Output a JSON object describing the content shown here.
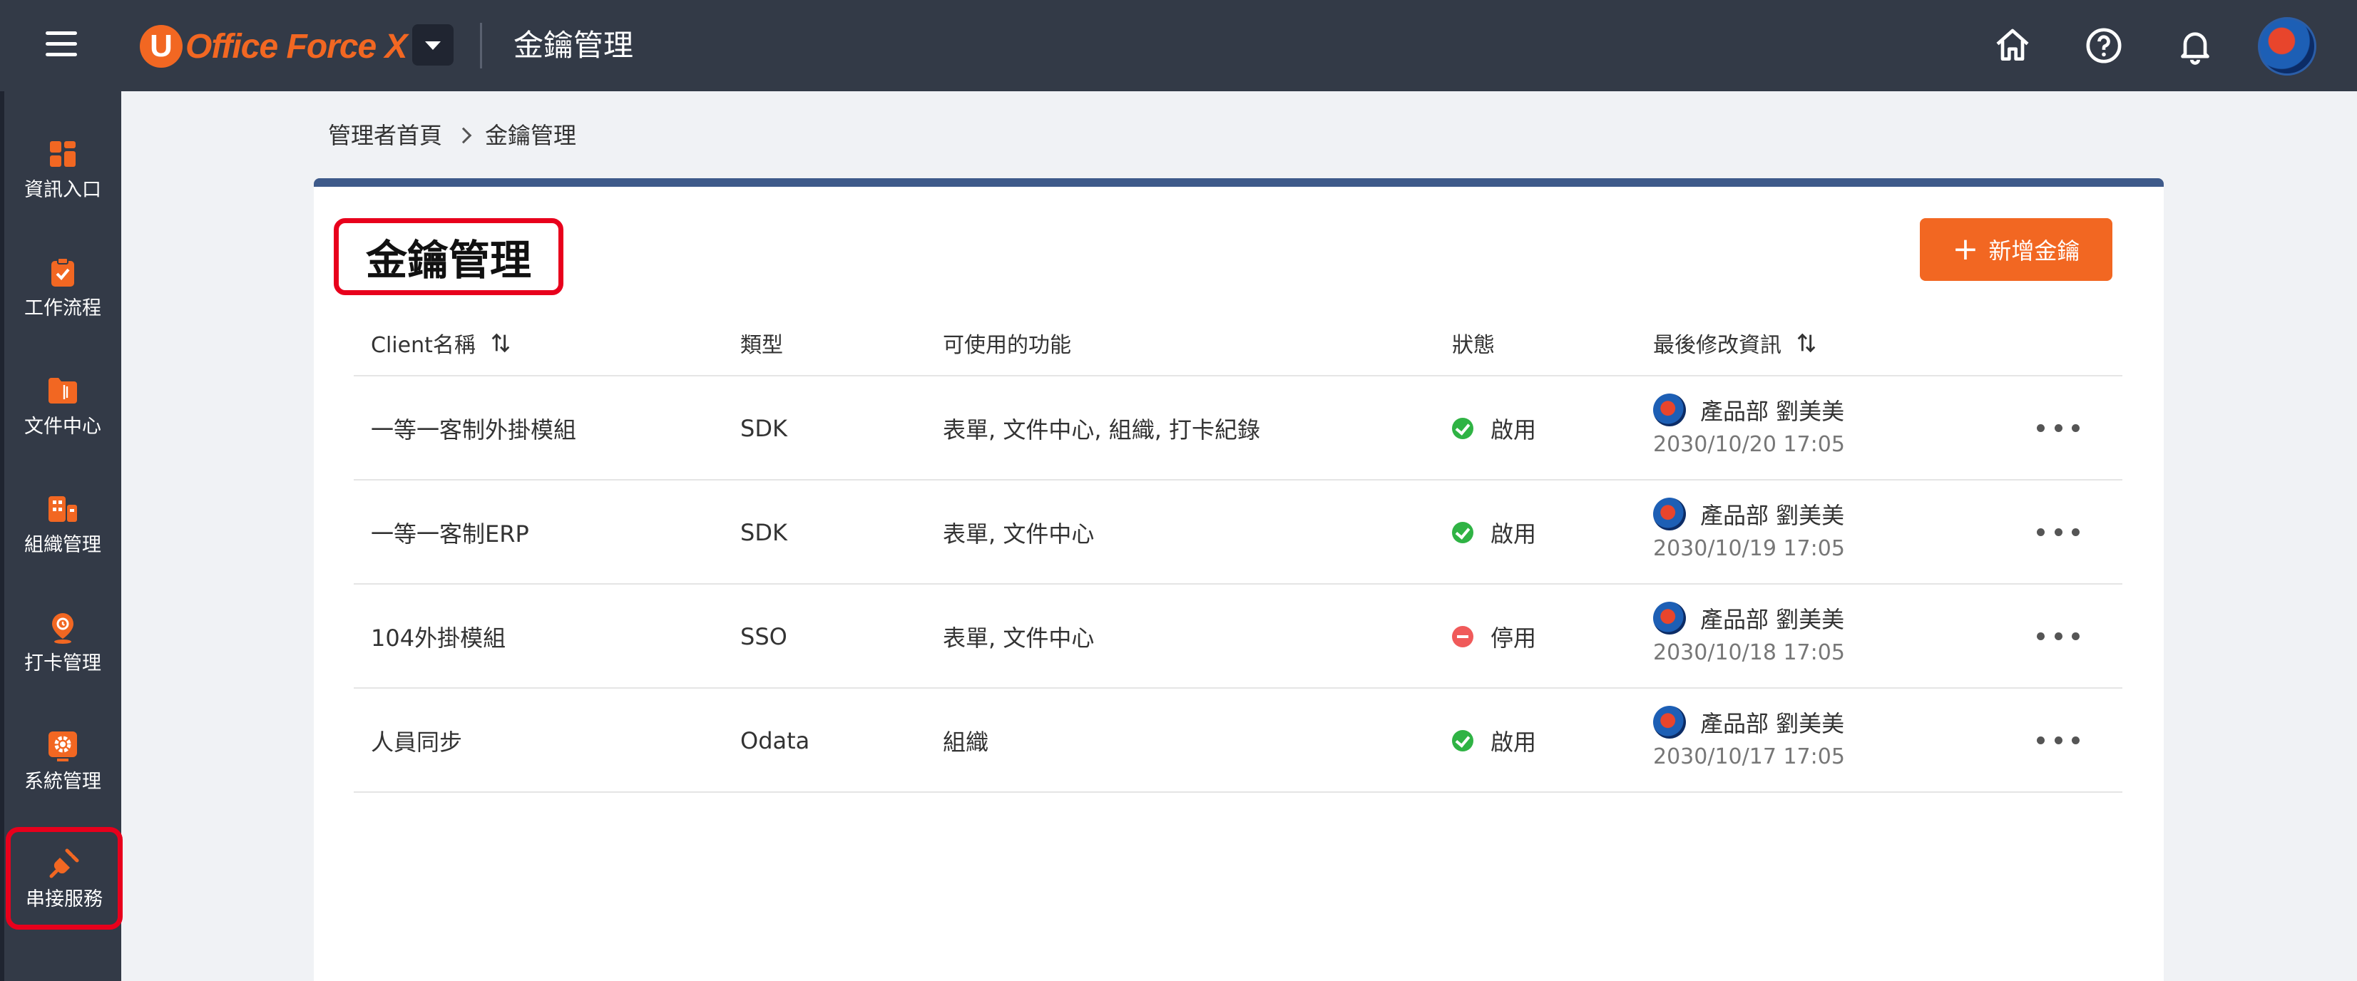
{
  "app": {
    "logo_text": "Office Force X",
    "logo_letter": "U",
    "page_title": "金鑰管理"
  },
  "colors": {
    "topbar": "#333a47",
    "accent": "#f26722",
    "highlight": "#e8001c",
    "card_top": "#3e5a8a",
    "enabled": "#2fb344",
    "disabled": "#f05a5a"
  },
  "topbar_icons": [
    "home-icon",
    "help-icon",
    "bell-icon",
    "user-avatar"
  ],
  "sidebar": {
    "items": [
      {
        "label": "資訊入口",
        "icon": "dashboard-icon"
      },
      {
        "label": "工作流程",
        "icon": "clipboard-check-icon"
      },
      {
        "label": "文件中心",
        "icon": "folder-icon"
      },
      {
        "label": "組織管理",
        "icon": "organization-icon"
      },
      {
        "label": "打卡管理",
        "icon": "location-pin-icon"
      },
      {
        "label": "系統管理",
        "icon": "gear-icon"
      },
      {
        "label": "串接服務",
        "icon": "plug-icon"
      }
    ]
  },
  "breadcrumb": {
    "home": "管理者首頁",
    "current": "金鑰管理"
  },
  "card": {
    "title": "金鑰管理",
    "add_button": "新增金鑰"
  },
  "table": {
    "headers": {
      "client": "Client名稱",
      "type": "類型",
      "features": "可使用的功能",
      "status": "狀態",
      "modified": "最後修改資訊"
    },
    "rows": [
      {
        "client": "一等一客制外掛模組",
        "type": "SDK",
        "features": "表單, 文件中心, 組織, 打卡紀錄",
        "status": "啟用",
        "status_kind": "enabled",
        "modifier": "產品部 劉美美",
        "date": "2030/10/20 17:05"
      },
      {
        "client": "一等一客制ERP",
        "type": "SDK",
        "features": "表單, 文件中心",
        "status": "啟用",
        "status_kind": "enabled",
        "modifier": "產品部 劉美美",
        "date": "2030/10/19 17:05"
      },
      {
        "client": "104外掛模組",
        "type": "SSO",
        "features": "表單, 文件中心",
        "status": "停用",
        "status_kind": "disabled",
        "modifier": "產品部 劉美美",
        "date": "2030/10/18 17:05"
      },
      {
        "client": "人員同步",
        "type": "Odata",
        "features": "組織",
        "status": "啟用",
        "status_kind": "enabled",
        "modifier": "產品部 劉美美",
        "date": "2030/10/17 17:05"
      }
    ]
  }
}
